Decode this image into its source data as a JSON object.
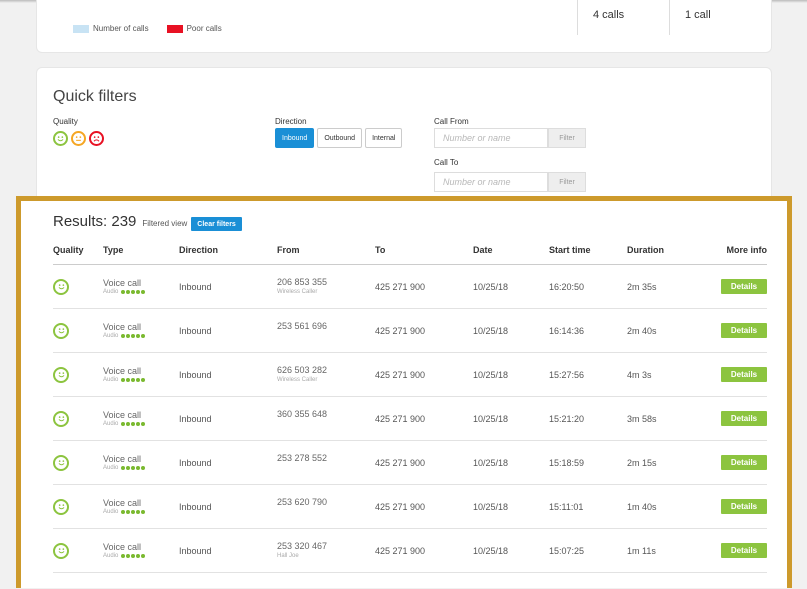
{
  "legend": {
    "number_of_calls": "Number of calls",
    "poor_calls": "Poor calls",
    "number_color": "#c8e3f4",
    "poor_color": "#e81123"
  },
  "top_stats": {
    "calls_a": "4 calls",
    "calls_b": "1 call"
  },
  "filters": {
    "title": "Quick filters",
    "quality_label": "Quality",
    "direction_label": "Direction",
    "direction_options": [
      "Inbound",
      "Outbound",
      "Internal"
    ],
    "direction_selected": "Inbound",
    "call_from_label": "Call From",
    "call_from_placeholder": "Number or name",
    "call_to_label": "Call To",
    "call_to_placeholder": "Number or name",
    "filter_button": "Filter",
    "quality_icons": [
      "good-face-icon",
      "neutral-face-icon",
      "poor-face-icon"
    ]
  },
  "results": {
    "title": "Results: 239",
    "filtered_view": "Filtered view",
    "clear_filters": "Clear filters",
    "columns": [
      "Quality",
      "Type",
      "Direction",
      "From",
      "To",
      "Date",
      "Start time",
      "Duration",
      "More info"
    ],
    "rows": [
      {
        "type": "Voice call",
        "audio": "Audio",
        "direction": "Inbound",
        "from": "206 853   355",
        "from_sub": "Wireless Caller",
        "to": "425 271   900",
        "date": "10/25/18",
        "start": "16:20:50",
        "duration": "2m 35s",
        "details": "Details"
      },
      {
        "type": "Voice call",
        "audio": "Audio",
        "direction": "Inbound",
        "from": "253 561   696",
        "from_sub": "",
        "to": "425 271   900",
        "date": "10/25/18",
        "start": "16:14:36",
        "duration": "2m 40s",
        "details": "Details"
      },
      {
        "type": "Voice call",
        "audio": "Audio",
        "direction": "Inbound",
        "from": "626 503   282",
        "from_sub": "Wireless Caller",
        "to": "425 271   900",
        "date": "10/25/18",
        "start": "15:27:56",
        "duration": "4m 3s",
        "details": "Details"
      },
      {
        "type": "Voice call",
        "audio": "Audio",
        "direction": "Inbound",
        "from": "360 355   648",
        "from_sub": "",
        "to": "425 271   900",
        "date": "10/25/18",
        "start": "15:21:20",
        "duration": "3m 58s",
        "details": "Details"
      },
      {
        "type": "Voice call",
        "audio": "Audio",
        "direction": "Inbound",
        "from": "253 278   552",
        "from_sub": "",
        "to": "425 271   900",
        "date": "10/25/18",
        "start": "15:18:59",
        "duration": "2m 15s",
        "details": "Details"
      },
      {
        "type": "Voice call",
        "audio": "Audio",
        "direction": "Inbound",
        "from": "253 620   790",
        "from_sub": "",
        "to": "425 271   900",
        "date": "10/25/18",
        "start": "15:11:01",
        "duration": "1m 40s",
        "details": "Details"
      },
      {
        "type": "Voice call",
        "audio": "Audio",
        "direction": "Inbound",
        "from": "253 320   467",
        "from_sub": "Hall Joe",
        "to": "425 271   900",
        "date": "10/25/18",
        "start": "15:07:25",
        "duration": "1m 11s",
        "details": "Details"
      }
    ]
  },
  "colors": {
    "accent_blue": "#1a8fd6",
    "good_green": "#8cc43f",
    "neutral_orange": "#f5a623",
    "poor_red": "#e81123",
    "highlight_frame": "#cd9a2c"
  }
}
